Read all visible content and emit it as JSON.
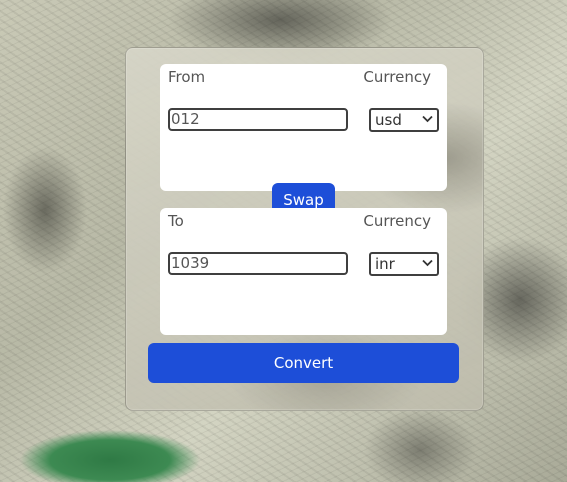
{
  "from": {
    "label": "From",
    "currency_label": "Currency",
    "amount": "012",
    "currency": "usd"
  },
  "swap_label": "Swap",
  "to": {
    "label": "To",
    "currency_label": "Currency",
    "amount": "1039",
    "currency": "inr"
  },
  "convert_label": "Convert",
  "colors": {
    "primary_button": "#1d4ed8",
    "button_text": "#ffffff",
    "panel_bg": "#ffffff",
    "label_text": "#555555",
    "input_border": "#3f3f3f"
  },
  "icons": {
    "select_arrow": "chevron-down-icon"
  }
}
